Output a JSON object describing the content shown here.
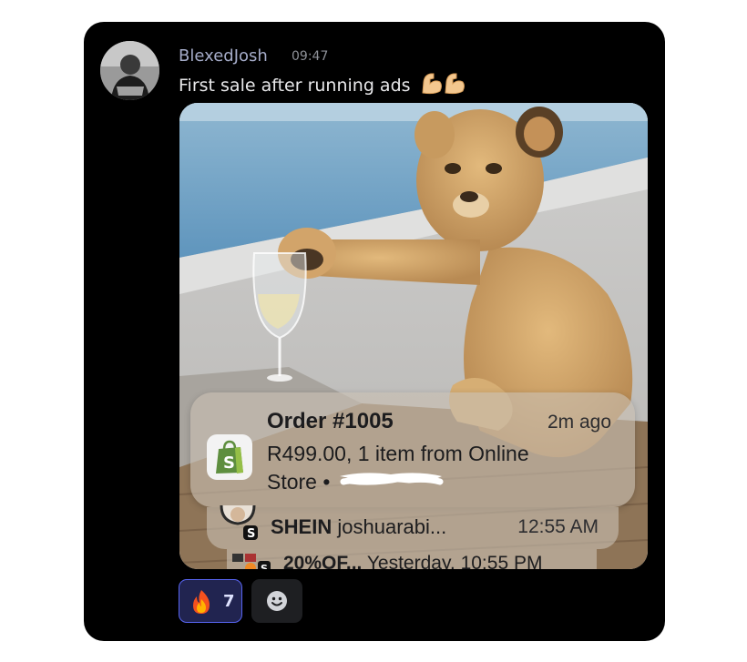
{
  "message": {
    "username": "BlexedJosh",
    "timestamp": "09:47",
    "text": "First sale after running ads",
    "emoji": "flexed-biceps-icon"
  },
  "notifications": [
    {
      "app_icon": "shopify-bag-icon",
      "title": "Order #1005",
      "time": "2m ago",
      "body_line1": "R499.00, 1 item from Online",
      "body_line2": "Store •"
    },
    {
      "app_icon": "shein-avatar-icon",
      "app": "SHEIN",
      "text": "joshuarabi...",
      "time": "12:55 AM"
    },
    {
      "app_icon": "app-group-icon",
      "text_bold": "20%OF...",
      "text": "Yesterday, 10:55 PM"
    }
  ],
  "reactions": [
    {
      "emoji": "fire-icon",
      "count": "7",
      "active": true
    }
  ],
  "colors": {
    "card_bg": "#000000",
    "username": "#a5acc9",
    "reaction_border": "#5865f2",
    "reaction_bg": "#212450",
    "shopify_green": "#5e8e3e"
  }
}
